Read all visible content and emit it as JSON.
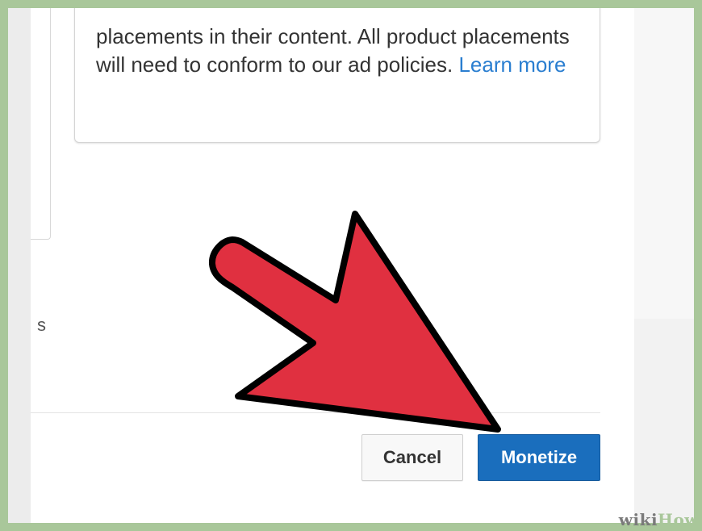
{
  "dialog": {
    "info_text": "placements in their content. All product placements will need to conform to our ad policies.",
    "learn_more_link": "Learn more",
    "partial_side_text": "s"
  },
  "actions": {
    "cancel_label": "Cancel",
    "monetize_label": "Monetize"
  },
  "overlay": {
    "arrow_icon": "red-pointer-arrow-icon",
    "arrow_color": "#e03040",
    "frame_color": "#a9c79a"
  },
  "watermark": {
    "wiki": "wiki",
    "how": "How"
  }
}
